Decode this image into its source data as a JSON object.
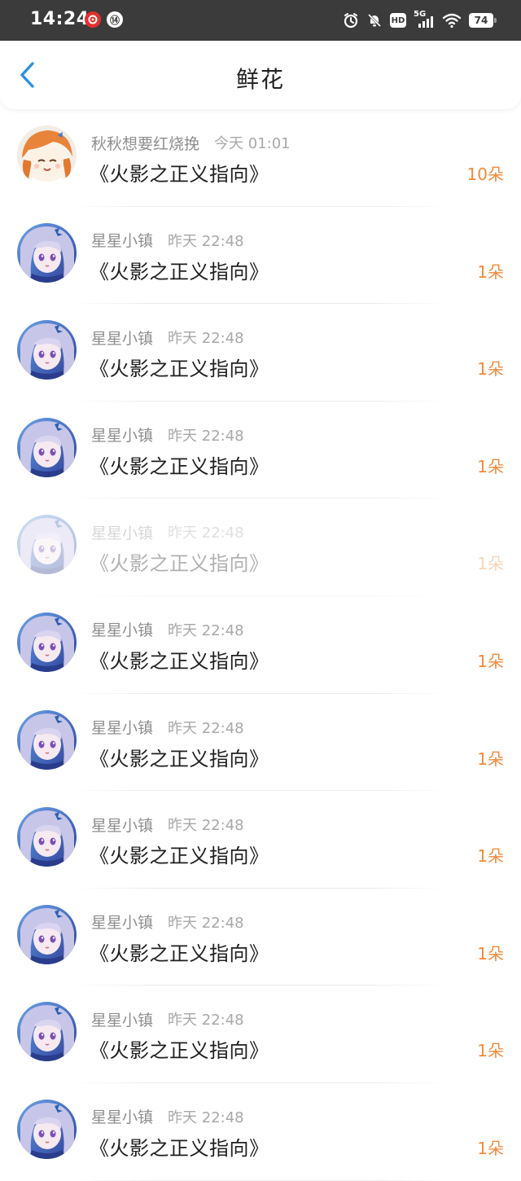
{
  "status_bar": {
    "time": "14:24",
    "app_icon_1": "netease-music-icon",
    "app_icon_2": "app-badge-icon",
    "app_icon_2_glyph": "⑭",
    "network": "5G",
    "hd_label": "HD",
    "battery": "74"
  },
  "header": {
    "title": "鲜花",
    "back_icon": "chevron-left-icon",
    "accent_color": "#2f8fe8"
  },
  "count_color": "#f08a3c",
  "records": [
    {
      "user": "秋秋想要红烧挽",
      "time": "今天 01:01",
      "title": "《火影之正义指向》",
      "count": "10朵",
      "avatar": "orange-hair-avatar",
      "faded": false
    },
    {
      "user": "星星小镇",
      "time": "昨天 22:48",
      "title": "《火影之正义指向》",
      "count": "1朵",
      "avatar": "blue-hair-avatar",
      "faded": false
    },
    {
      "user": "星星小镇",
      "time": "昨天 22:48",
      "title": "《火影之正义指向》",
      "count": "1朵",
      "avatar": "blue-hair-avatar",
      "faded": false
    },
    {
      "user": "星星小镇",
      "time": "昨天 22:48",
      "title": "《火影之正义指向》",
      "count": "1朵",
      "avatar": "blue-hair-avatar",
      "faded": false
    },
    {
      "user": "星星小镇",
      "time": "昨天 22:48",
      "title": "《火影之正义指向》",
      "count": "1朵",
      "avatar": "blue-hair-avatar",
      "faded": true
    },
    {
      "user": "星星小镇",
      "time": "昨天 22:48",
      "title": "《火影之正义指向》",
      "count": "1朵",
      "avatar": "blue-hair-avatar",
      "faded": false
    },
    {
      "user": "星星小镇",
      "time": "昨天 22:48",
      "title": "《火影之正义指向》",
      "count": "1朵",
      "avatar": "blue-hair-avatar",
      "faded": false
    },
    {
      "user": "星星小镇",
      "time": "昨天 22:48",
      "title": "《火影之正义指向》",
      "count": "1朵",
      "avatar": "blue-hair-avatar",
      "faded": false
    },
    {
      "user": "星星小镇",
      "time": "昨天 22:48",
      "title": "《火影之正义指向》",
      "count": "1朵",
      "avatar": "blue-hair-avatar",
      "faded": false
    },
    {
      "user": "星星小镇",
      "time": "昨天 22:48",
      "title": "《火影之正义指向》",
      "count": "1朵",
      "avatar": "blue-hair-avatar",
      "faded": false
    },
    {
      "user": "星星小镇",
      "time": "昨天 22:48",
      "title": "《火影之正义指向》",
      "count": "1朵",
      "avatar": "blue-hair-avatar",
      "faded": false
    }
  ]
}
